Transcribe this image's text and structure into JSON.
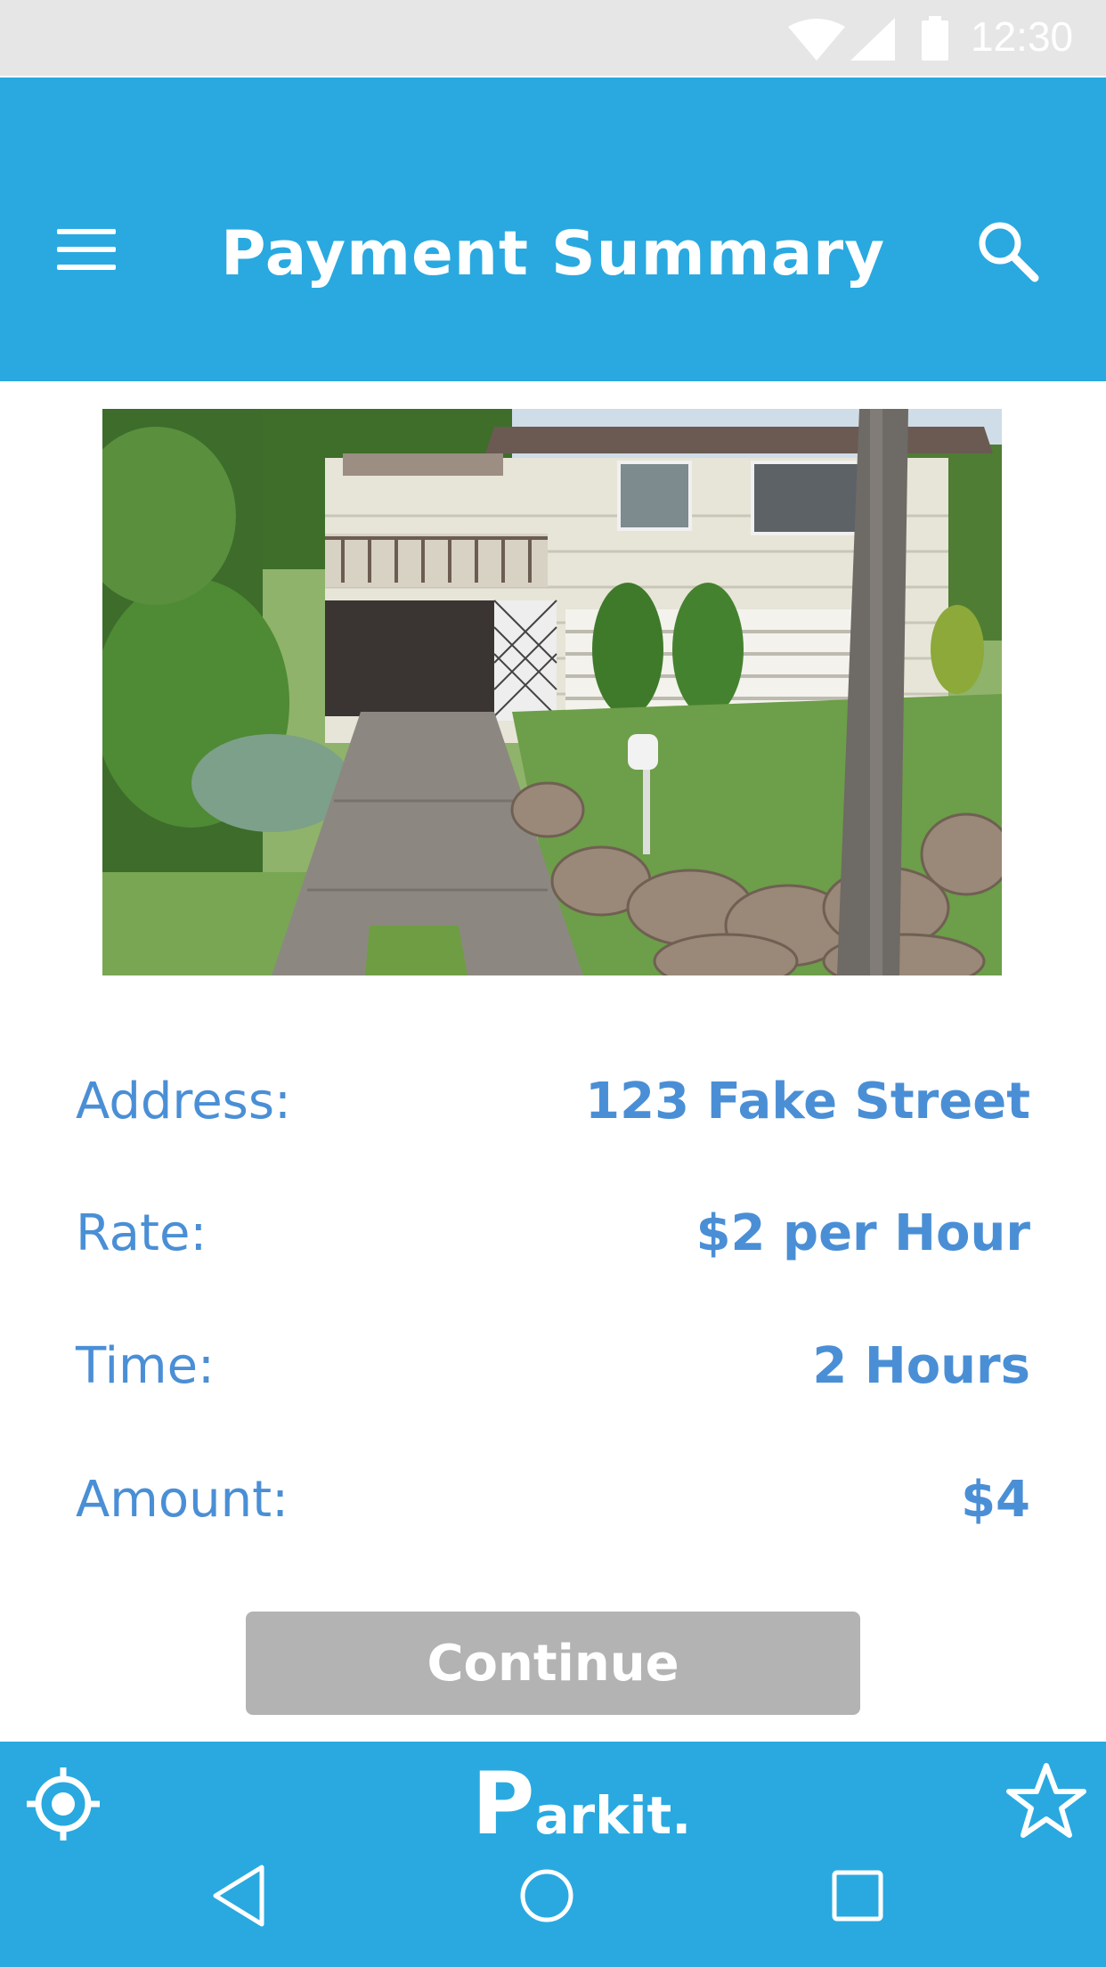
{
  "status_bar": {
    "time": "12:30",
    "icons": [
      "wifi-icon",
      "signal-icon",
      "battery-icon"
    ]
  },
  "header": {
    "title": "Payment Summary",
    "menu_icon": "menu-icon",
    "search_icon": "search-icon"
  },
  "listing": {
    "photo": "house-photo"
  },
  "details": [
    {
      "label": "Address:",
      "value": "123 Fake Street"
    },
    {
      "label": "Rate:",
      "value": "$2 per Hour"
    },
    {
      "label": "Time:",
      "value": "2 Hours"
    },
    {
      "label": "Amount:",
      "value": "$4"
    }
  ],
  "actions": {
    "continue_label": "Continue"
  },
  "bottom_bar": {
    "logo_first": "P",
    "logo_rest": "arkit.",
    "locate_icon": "locate-icon",
    "favorite_icon": "star-icon"
  },
  "nav": {
    "icons": [
      "back-icon",
      "home-icon",
      "recents-icon"
    ]
  },
  "colors": {
    "primary": "#29a9e0",
    "label": "#4a8fd6",
    "button_disabled": "#b3b3b3",
    "status_bar": "#e6e6e6"
  }
}
